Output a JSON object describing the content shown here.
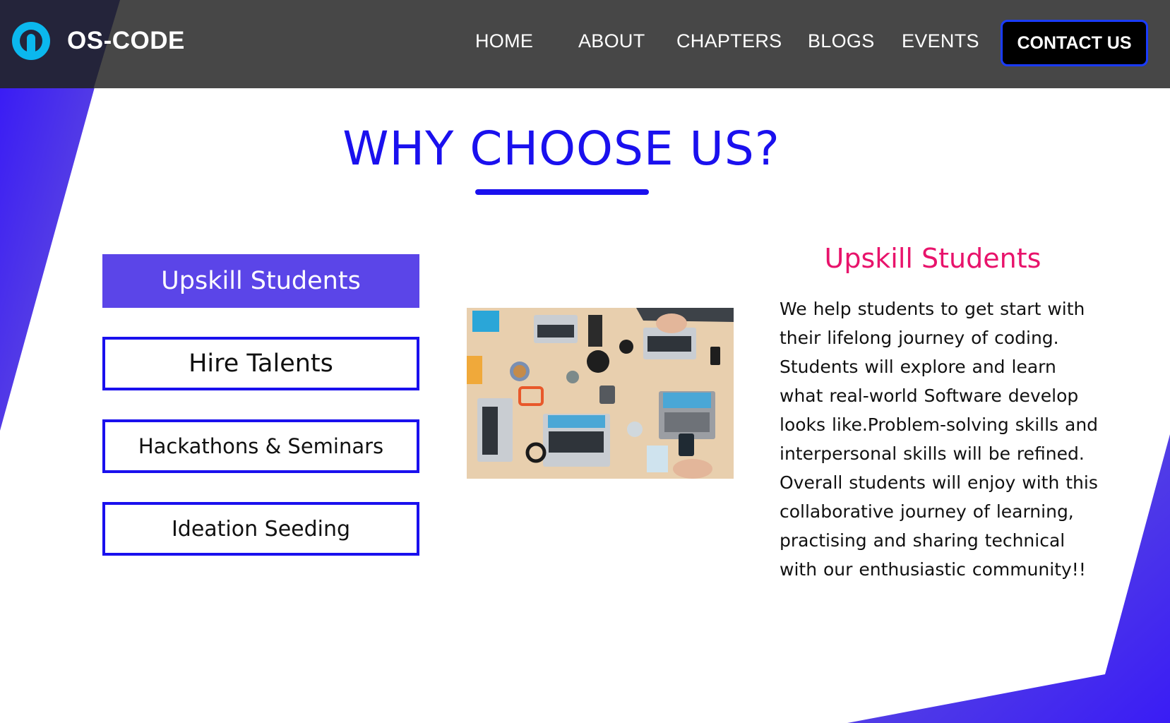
{
  "brand": {
    "name": "OS-CODE",
    "logo_icon": "rocket-icon",
    "accent": "#0bb8ee"
  },
  "nav": {
    "items": [
      {
        "label": "HOME"
      },
      {
        "label": "ABOUT"
      },
      {
        "label": "CHAPTERS"
      },
      {
        "label": "BLOGS"
      },
      {
        "label": "EVENTS"
      }
    ],
    "contact_label": "CONTACT US"
  },
  "section": {
    "title": "WHY CHOOSE US?"
  },
  "tabs": [
    {
      "label": "Upskill Students",
      "active": true
    },
    {
      "label": "Hire Talents",
      "active": false
    },
    {
      "label": "Hackathons & Seminars",
      "active": false
    },
    {
      "label": "Ideation Seeding",
      "active": false
    }
  ],
  "detail": {
    "title": "Upskill Students",
    "lines": [
      "We help students to get start with",
      "their lifelong journey of coding.",
      "Students will explore and learn",
      "what real-world Software develop",
      "looks like.Problem-solving skills and",
      "interpersonal skills will be refined.",
      "Overall students will enjoy with this",
      "collaborative journey of learning,",
      "practising and sharing technical",
      "with our enthusiastic community!!"
    ]
  },
  "colors": {
    "header_bg": "#474747",
    "primary_blue": "#1a10ee",
    "active_tab": "#5b45e8",
    "heading_pink": "#e8136b",
    "deco_purple": "#4a2cf0"
  }
}
